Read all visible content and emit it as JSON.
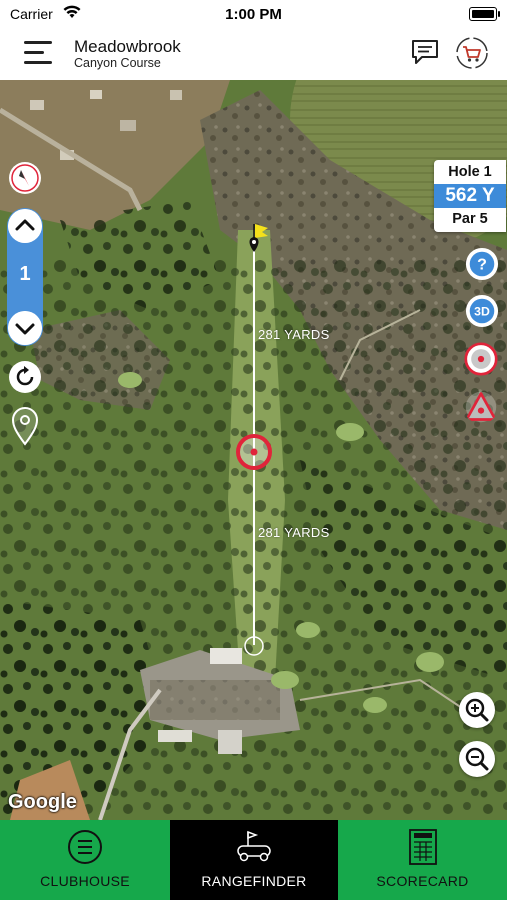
{
  "status_bar": {
    "carrier": "Carrier",
    "time": "1:00 PM"
  },
  "header": {
    "title": "Meadowbrook",
    "subtitle": "Canyon Course",
    "menu_icon": "hamburger-menu-icon",
    "chat_icon": "chat-bubble-icon",
    "cart_icon": "shopping-cart-icon"
  },
  "hole_info": {
    "hole": "Hole 1",
    "yards": "562 Y",
    "par": "Par 5"
  },
  "hole_nav": {
    "current": "1"
  },
  "map": {
    "distance_top": "281 YARDS",
    "distance_bottom": "281 YARDS",
    "attribution": "Google"
  },
  "right_controls": [
    "help-icon",
    "3d-view-icon",
    "target-icon",
    "hazard-icon"
  ],
  "left_controls": [
    "compass-icon",
    "refresh-icon",
    "location-pin-icon"
  ],
  "tabs": [
    {
      "label": "CLUBHOUSE",
      "icon": "clubhouse-menu-icon",
      "active": false
    },
    {
      "label": "RANGEFINDER",
      "icon": "golf-cart-flag-icon",
      "active": true
    },
    {
      "label": "SCORECARD",
      "icon": "scorecard-icon",
      "active": false
    }
  ],
  "colors": {
    "tab_green": "#16a84b",
    "tab_active": "#000000",
    "accent_blue": "#3d8bd9",
    "target_red": "#e0243a"
  }
}
